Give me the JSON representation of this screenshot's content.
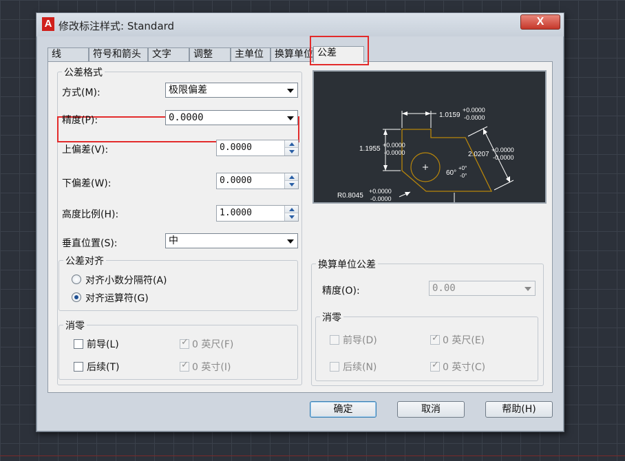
{
  "window": {
    "title": "修改标注样式: Standard",
    "close_label": "X",
    "logo_letter": "A"
  },
  "tabs": [
    "线",
    "符号和箭头",
    "文字",
    "调整",
    "主单位",
    "换算单位",
    "公差"
  ],
  "active_tab": "公差",
  "tolerance_format": {
    "group_label": "公差格式",
    "method_label": "方式(M):",
    "method_value": "极限偏差",
    "precision_label": "精度(P):",
    "precision_value": "0.0000",
    "upper_label": "上偏差(V):",
    "upper_value": "0.0000",
    "lower_label": "下偏差(W):",
    "lower_value": "0.0000",
    "height_label": "高度比例(H):",
    "height_value": "1.0000",
    "vpos_label": "垂直位置(S):",
    "vpos_value": "中"
  },
  "alignment": {
    "group_label": "公差对齐",
    "opt1": "对齐小数分隔符(A)",
    "opt2": "对齐运算符(G)",
    "selected": "opt2"
  },
  "zero_primary": {
    "group_label": "消零",
    "leading": "前导(L)",
    "trailing": "后续(T)",
    "feet": "0 英尺(F)",
    "inches": "0 英寸(I)"
  },
  "alt_tolerance": {
    "group_label": "换算单位公差",
    "precision_label": "精度(O):",
    "precision_value": "0.00",
    "zero_label": "消零",
    "leading": "前导(D)",
    "trailing": "后续(N)",
    "feet": "0 英尺(E)",
    "inches": "0 英寸(C)"
  },
  "preview": {
    "dim_top": "1.0159",
    "dim_left": "1.1955",
    "dim_right": "2.0207",
    "angle": "60°",
    "radius": "R0.8045",
    "tol_plus": "+0.0000",
    "tol_minus": "-0.0000",
    "ang_plus": "+0°",
    "ang_minus": "-0°"
  },
  "buttons": {
    "ok": "确定",
    "cancel": "取消",
    "help": "帮助(H)"
  },
  "colors": {
    "highlight": "#e32a2a",
    "preview_bg": "#2b3036",
    "geometry": "#b8860b"
  }
}
